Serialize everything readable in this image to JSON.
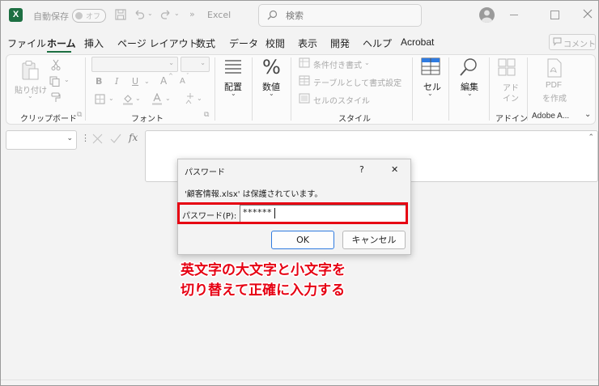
{
  "titlebar": {
    "app_icon": "X",
    "autosave_label": "自動保存",
    "autosave_state": "オフ",
    "app_name": "Excel",
    "search_placeholder": "検索",
    "more": "»"
  },
  "menu": {
    "items": [
      "ファイル",
      "ホーム",
      "挿入",
      "ページ レイアウト",
      "数式",
      "データ",
      "校閲",
      "表示",
      "開発",
      "ヘルプ",
      "Acrobat"
    ],
    "active": "ホーム",
    "comment_button": "コメント"
  },
  "ribbon": {
    "clipboard": {
      "paste": "貼り付け",
      "label": "クリップボード"
    },
    "font": {
      "bold": "B",
      "italic": "I",
      "underline": "U",
      "grow": "A",
      "shrink": "A",
      "label": "フォント"
    },
    "alignment": {
      "label": "配置"
    },
    "number": {
      "symbol": "%",
      "label": "数値"
    },
    "styles": {
      "conditional": "条件付き書式",
      "table": "テーブルとして書式設定",
      "cell_style": "セルのスタイル",
      "label": "スタイル"
    },
    "cells": {
      "label": "セル"
    },
    "editing": {
      "label": "編集"
    },
    "addin": {
      "line1": "アド",
      "line2": "イン",
      "label": "アドイン"
    },
    "pdf": {
      "line1": "PDF",
      "line2": "を作成",
      "label": "Adobe A..."
    }
  },
  "formula_bar": {
    "fx": "fx"
  },
  "dialog": {
    "title": "パスワード",
    "help": "?",
    "close": "✕",
    "message": "'顧客情報.xlsx' は保護されています。",
    "password_label": "パスワード(P):",
    "password_value": "******",
    "ok": "OK",
    "cancel": "キャンセル"
  },
  "annotation": {
    "line1": "英文字の大文字と小文字を",
    "line2": "切り替えて正確に入力する"
  },
  "colors": {
    "excel_green": "#1d6f42",
    "annotation_red": "#e60012",
    "ok_border": "#2f7be0"
  }
}
